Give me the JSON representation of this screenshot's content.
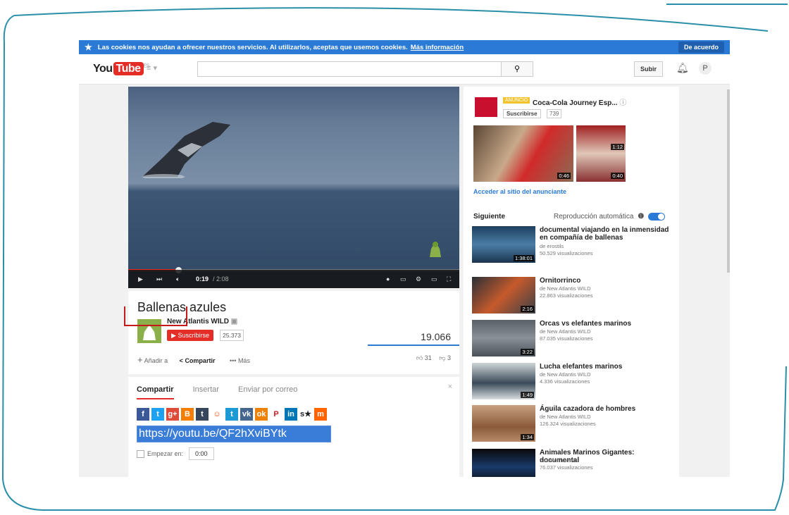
{
  "cookie_bar": {
    "text": "Las cookies nos ayudan a ofrecer nuestros servicios. Al utilizarlos, aceptas que usemos cookies.",
    "more_link": "Más información",
    "accept_button": "De acuerdo"
  },
  "header": {
    "logo_you": "You",
    "logo_tube": "Tube",
    "logo_region": "ES",
    "upload_button": "Subir",
    "avatar_letter": "P"
  },
  "player": {
    "current_time": "0:19",
    "duration": "/ 2:08",
    "progress_fraction": 0.15
  },
  "video_info": {
    "title": "Ballenas azules",
    "channel_name": "New Atlantis WILD",
    "subscribe_label": "Suscribirse",
    "subscriber_count": "25.373",
    "view_count": "19.066",
    "add_to_label": "Añadir a",
    "share_label": "Compartir",
    "more_label": "Más",
    "likes": "31",
    "dislikes": "3"
  },
  "share_panel": {
    "tabs": [
      "Compartir",
      "Insertar",
      "Enviar por correo"
    ],
    "url": "https://youtu.be/QF2hXviBYtk",
    "start_at_label": "Empezar en:",
    "start_time": "0:00",
    "social_icons": [
      "facebook-icon",
      "twitter-icon",
      "google-plus-icon",
      "blogger-icon",
      "tumblr-icon",
      "reddit-icon",
      "tuenti-icon",
      "vk-icon",
      "odnoklassniki-icon",
      "pinterest-icon",
      "linkedin-icon",
      "stumbleupon-icon",
      "meneame-icon"
    ]
  },
  "ad": {
    "badge": "ANUNCIO",
    "title": "Coca-Cola Journey Esp...",
    "subscribe_label": "Suscribirse",
    "subscriber_count": "739",
    "duration1": "0:46",
    "duration2": "1:12",
    "duration3": "0:40",
    "link": "Acceder al sitio del anunciante"
  },
  "sidebar": {
    "next_heading": "Siguiente",
    "autoplay_label": "Reproducción automática",
    "items": [
      {
        "title": "documental viajando en la inmensidad en compañía de ballenas",
        "channel": "de erostils",
        "views": "50.529 visualizaciones",
        "duration": "1:38:01"
      },
      {
        "title": "Ornitorrinco",
        "channel": "de New Atlantis WILD",
        "views": "22.863 visualizaciones",
        "duration": "2:16"
      },
      {
        "title": "Orcas vs elefantes marinos",
        "channel": "de New Atlantis WILD",
        "views": "87.035 visualizaciones",
        "duration": "3:22"
      },
      {
        "title": "Lucha elefantes marinos",
        "channel": "de New Atlantis WILD",
        "views": "4.336 visualizaciones",
        "duration": "1:49"
      },
      {
        "title": "Águila cazadora de hombres",
        "channel": "de New Atlantis WILD",
        "views": "126.324 visualizaciones",
        "duration": "1:34"
      },
      {
        "title": "Animales Marinos Gigantes: documental",
        "channel": "de satelliteterra",
        "views": "76.037 visualizaciones",
        "duration": ""
      }
    ]
  }
}
